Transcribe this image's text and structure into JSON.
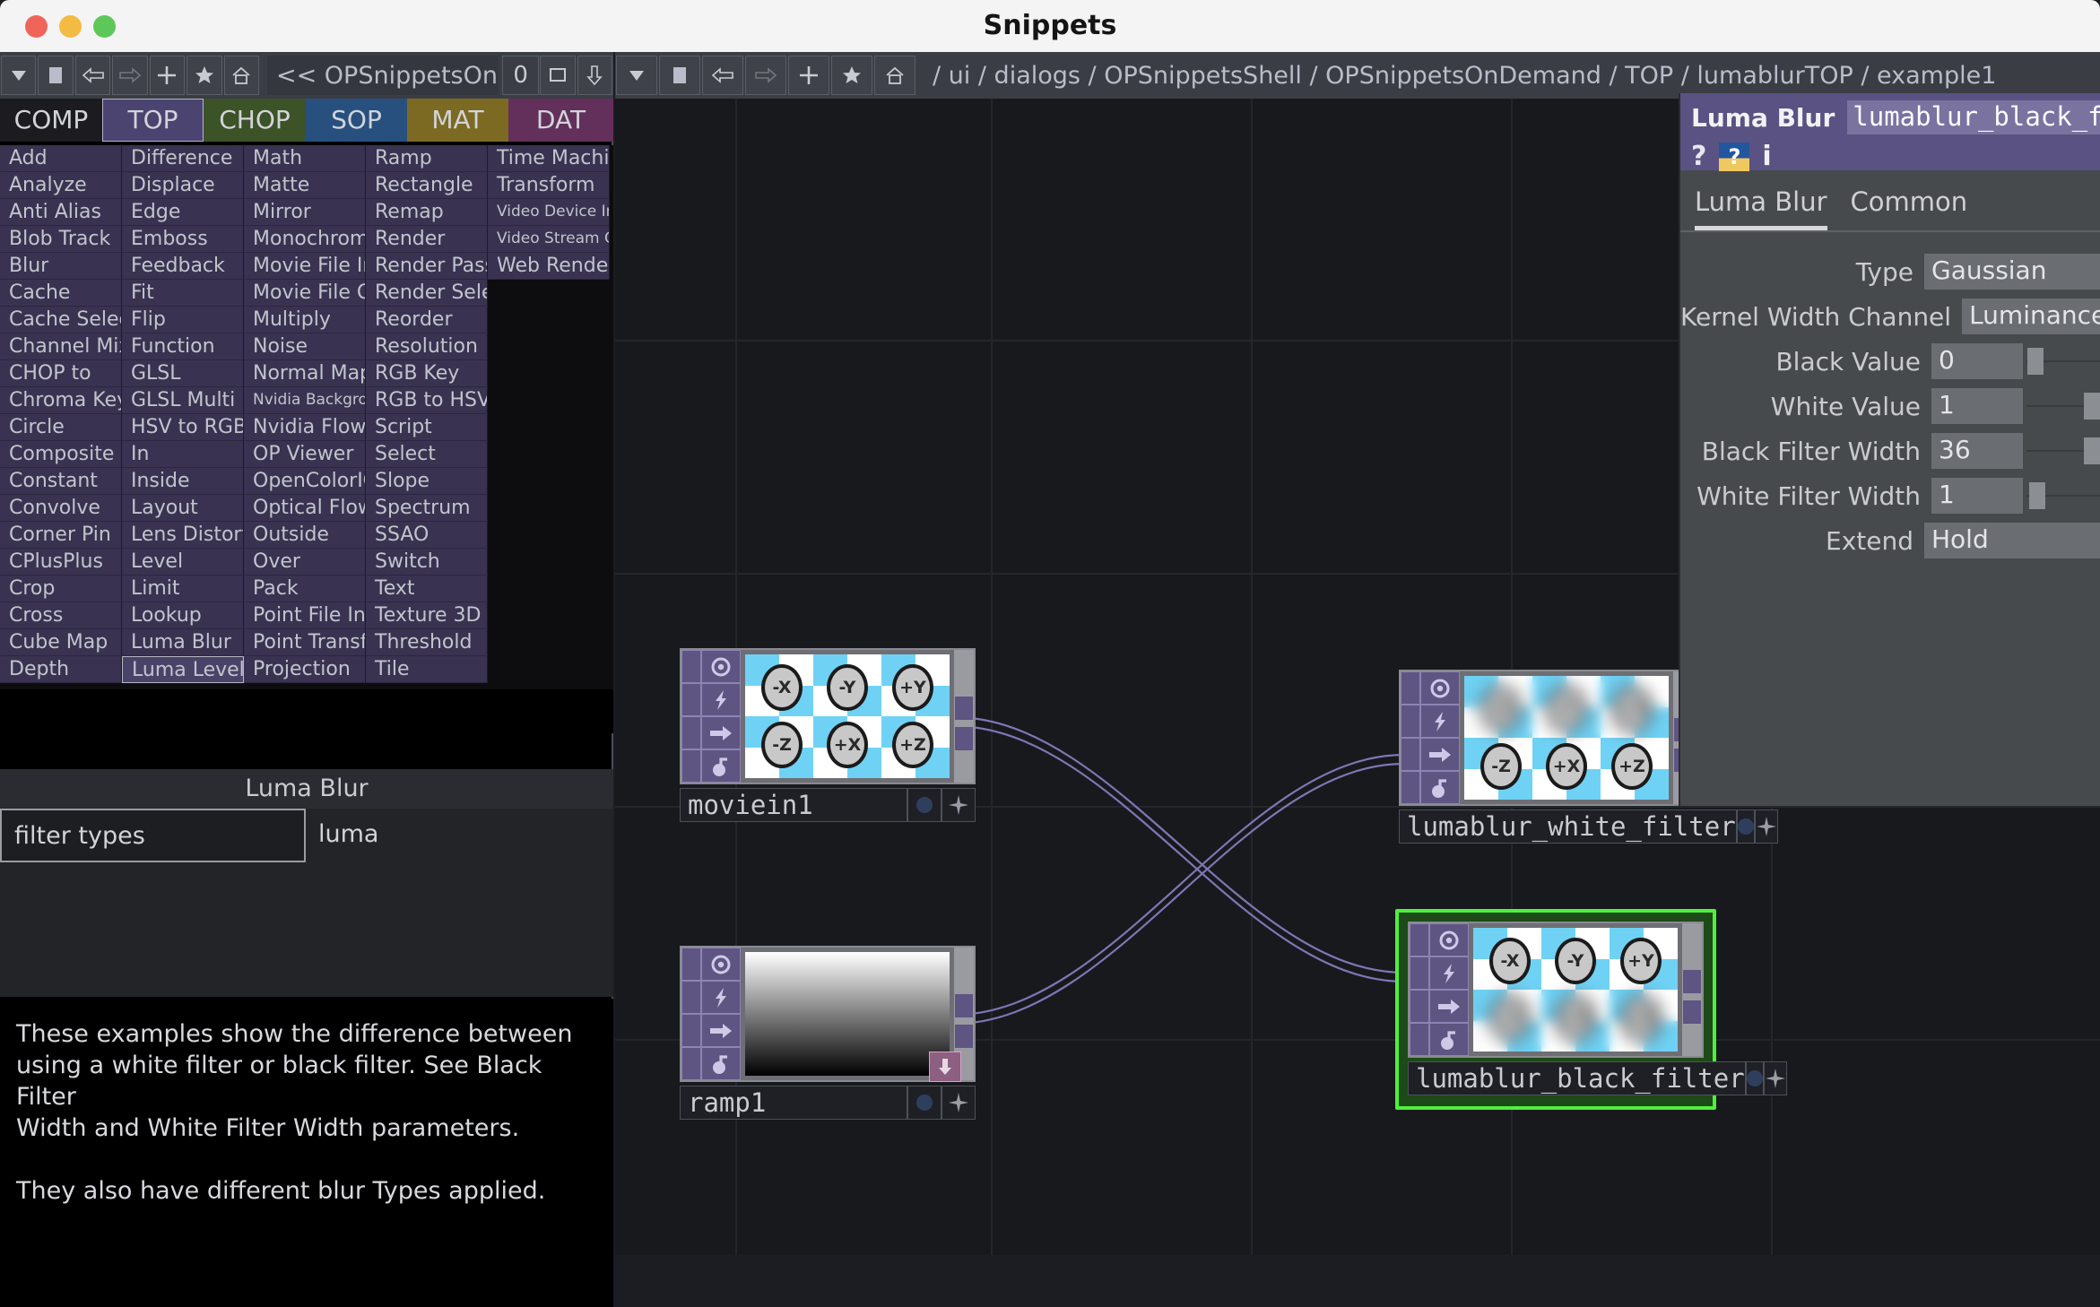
{
  "window": {
    "title": "Snippets"
  },
  "left_toolbar": {
    "buttons": [
      "chevron-down-icon",
      "stop-icon",
      "back-arrow-icon",
      "forward-arrow-icon",
      "plus-icon",
      "star-icon",
      "home-icon"
    ],
    "path": "<< OPSnippetsOn",
    "counter": "0",
    "panel_label": "square-icon",
    "down_label": "down-arrow-icon"
  },
  "type_tabs": [
    {
      "label": "COMP",
      "key": "comp"
    },
    {
      "label": "TOP",
      "key": "top"
    },
    {
      "label": "CHOP",
      "key": "chop"
    },
    {
      "label": "SOP",
      "key": "sop"
    },
    {
      "label": "MAT",
      "key": "mat"
    },
    {
      "label": "DAT",
      "key": "dat"
    }
  ],
  "active_type_tab": "TOP",
  "operator_columns": [
    [
      "Add",
      "Analyze",
      "Anti Alias",
      "Blob Track",
      "Blur",
      "Cache",
      "Cache Select",
      "Channel Mix",
      "CHOP to",
      "Chroma Key",
      "Circle",
      "Composite",
      "Constant",
      "Convolve",
      "Corner Pin",
      "CPlusPlus",
      "Crop",
      "Cross",
      "Cube Map",
      "Depth"
    ],
    [
      "Difference",
      "Displace",
      "Edge",
      "Emboss",
      "Feedback",
      "Fit",
      "Flip",
      "Function",
      "GLSL",
      "GLSL Multi",
      "HSV to RGB",
      "In",
      "Inside",
      "Layout",
      "Lens Distort",
      "Level",
      "Limit",
      "Lookup",
      "Luma Blur",
      "Luma Level"
    ],
    [
      "Math",
      "Matte",
      "Mirror",
      "Monochrome",
      "Movie File In",
      "Movie File Out",
      "Multiply",
      "Noise",
      "Normal Map",
      "Nvidia Background",
      "Nvidia Flow",
      "OP Viewer",
      "OpenColorIO",
      "Optical Flow",
      "Outside",
      "Over",
      "Pack",
      "Point File In",
      "Point Transform",
      "Projection"
    ],
    [
      "Ramp",
      "Rectangle",
      "Remap",
      "Render",
      "Render Pass",
      "Render Select",
      "Reorder",
      "Resolution",
      "RGB Key",
      "RGB to HSV",
      "Script",
      "Select",
      "Slope",
      "Spectrum",
      "SSAO",
      "Switch",
      "Text",
      "Texture 3D",
      "Threshold",
      "Tile"
    ],
    [
      "Time Machine",
      "Transform",
      "Video Device In",
      "Video Stream Out",
      "Web Render"
    ]
  ],
  "selected_operator": "Luma Level",
  "small_font_operators": [
    "Nvidia Background",
    "Video Device In",
    "Video Stream Out"
  ],
  "snippet_panel": {
    "header": "Luma Blur",
    "items": [
      {
        "label": "filter types",
        "selected": true
      },
      {
        "label": "luma",
        "selected": false
      }
    ],
    "description": "These examples show the difference between\nusing a white filter or black filter. See Black Filter\nWidth and White Filter Width parameters.\n\nThey also have different blur Types applied."
  },
  "net_toolbar": {
    "buttons": [
      "chevron-down-icon",
      "stop-icon",
      "back-arrow-icon",
      "forward-arrow-icon",
      "plus-icon",
      "star-icon",
      "home-icon"
    ],
    "path": "/ ui / dialogs / OPSnippetsShell / OPSnippetsOnDemand / TOP / lumablurTOP / example1"
  },
  "nodes": [
    {
      "name": "moviein1",
      "kind": "cubemap",
      "selected": false,
      "viewer_labels": [
        "-X",
        "-Y",
        "+Y",
        "-Z",
        "+X",
        "+Z"
      ],
      "blur_row": "none"
    },
    {
      "name": "lumablur_white_filter",
      "kind": "cubemap",
      "selected": false,
      "viewer_labels": [
        "-X",
        "-Y",
        "+Y",
        "-Z",
        "+X",
        "+Z"
      ],
      "blur_row": "top"
    },
    {
      "name": "ramp1",
      "kind": "ramp",
      "selected": false,
      "viewer_labels": [],
      "blur_row": "none"
    },
    {
      "name": "lumablur_black_filter",
      "kind": "cubemap",
      "selected": true,
      "viewer_labels": [
        "-X",
        "-Y",
        "+Y",
        "-Z",
        "+X",
        "+Z"
      ],
      "blur_row": "bottom"
    }
  ],
  "parameters": {
    "op_type": "Luma Blur",
    "op_name": "lumablur_black_filter",
    "help_icons": [
      "question-mark-icon",
      "help-card-icon",
      "info-icon"
    ],
    "tabs": [
      {
        "label": "Luma Blur",
        "active": true
      },
      {
        "label": "Common",
        "active": false
      }
    ],
    "rows": [
      {
        "label": "Type",
        "value": "Gaussian",
        "kind": "menu"
      },
      {
        "label": "Kernel Width Channel",
        "value": "Luminance",
        "kind": "menu"
      },
      {
        "label": "Black Value",
        "value": "0",
        "kind": "num",
        "slider": 0.02
      },
      {
        "label": "White Value",
        "value": "1",
        "kind": "num",
        "slider": 1.0
      },
      {
        "label": "Black Filter Width",
        "value": "36",
        "kind": "num",
        "slider": 1.0
      },
      {
        "label": "White Filter Width",
        "value": "1",
        "kind": "num",
        "slider": 0.05
      },
      {
        "label": "Extend",
        "value": "Hold",
        "kind": "menu"
      }
    ]
  },
  "colors": {
    "accent_purple": "#5e5582",
    "selection_green": "#4ef03c",
    "top_tab": "#4c4470",
    "chop_tab": "#3c5227",
    "sop_tab": "#27507e",
    "mat_tab": "#7c6a23",
    "dat_tab": "#62305b"
  }
}
